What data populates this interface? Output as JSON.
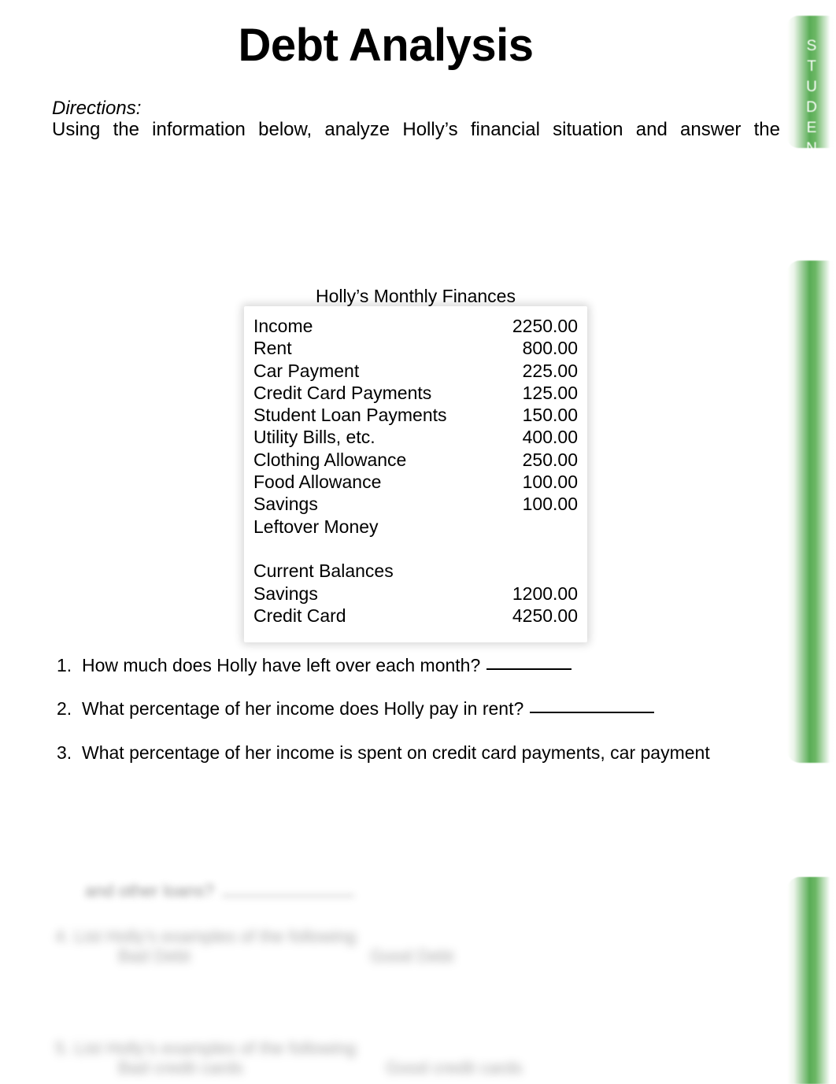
{
  "document": {
    "title": "Debt Analysis",
    "side_tab_letters": [
      "S",
      "T",
      "U",
      "D",
      "E",
      "N"
    ],
    "accent_color": "#5aad56"
  },
  "directions": {
    "label": "Directions:",
    "body": "Using the information below, analyze Holly’s financial situation and answer the"
  },
  "finance_table": {
    "caption": "Holly’s Monthly Finances",
    "rows": [
      {
        "label": "Income",
        "value": "2250.00"
      },
      {
        "label": "Rent",
        "value": "800.00"
      },
      {
        "label": "Car Payment",
        "value": "225.00"
      },
      {
        "label": "Credit Card Payments",
        "value": "125.00"
      },
      {
        "label": "Student Loan Payments",
        "value": "150.00"
      },
      {
        "label": "Utility Bills, etc.",
        "value": "400.00"
      },
      {
        "label": "Clothing Allowance",
        "value": "250.00"
      },
      {
        "label": "Food Allowance",
        "value": "100.00"
      },
      {
        "label": "Savings",
        "value": "100.00"
      },
      {
        "label": "Leftover Money",
        "value": ""
      },
      {
        "label": "",
        "value": ""
      },
      {
        "label": "Current Balances",
        "value": ""
      },
      {
        "label": "Savings",
        "value": "1200.00"
      },
      {
        "label": "Credit Card",
        "value": "4250.00"
      }
    ]
  },
  "questions": [
    {
      "number": "1.",
      "text": "How much does Holly have left over each month?"
    },
    {
      "number": "2.",
      "text": "What percentage of her income does Holly pay in rent?"
    },
    {
      "number": "3.",
      "text": "What percentage of her income is spent on credit card payments, car payment"
    }
  ],
  "blurred_section": {
    "question3_continuation": "and other loans?",
    "question4": "4.  List Holly’s examples of the following",
    "question4_col1": "Bad Debt",
    "question4_col2": "Good Debt",
    "question5": "5.  List Holly’s examples of the following",
    "question5_col1": "Bad  credit cards",
    "question5_col2": "Good  credit cards"
  }
}
